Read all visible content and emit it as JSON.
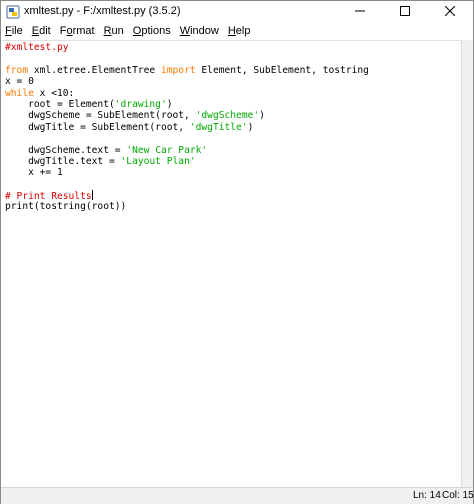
{
  "window": {
    "title": "xmltest.py - F:/xmltest.py (3.5.2)"
  },
  "menu": {
    "items": [
      {
        "accel": "F",
        "rest": "ile"
      },
      {
        "accel": "E",
        "rest": "dit"
      },
      {
        "pre": "F",
        "accel": "o",
        "rest": "rmat"
      },
      {
        "accel": "R",
        "rest": "un"
      },
      {
        "accel": "O",
        "rest": "ptions"
      },
      {
        "accel": "W",
        "rest": "indow"
      },
      {
        "accel": "H",
        "rest": "elp"
      }
    ]
  },
  "editor": {
    "lines": [
      {
        "indent": "",
        "parts": [
          {
            "t": "#xmltest.py",
            "c": "cmt"
          }
        ]
      },
      {
        "indent": "",
        "parts": []
      },
      {
        "indent": "",
        "parts": [
          {
            "t": "from",
            "c": "kw"
          },
          {
            "t": " xml.etree.ElementTree ",
            "c": ""
          },
          {
            "t": "import",
            "c": "kw"
          },
          {
            "t": " Element, SubElement, tostring",
            "c": ""
          }
        ]
      },
      {
        "indent": "",
        "parts": [
          {
            "t": "x = 0",
            "c": ""
          }
        ]
      },
      {
        "indent": "",
        "parts": [
          {
            "t": "while",
            "c": "kw"
          },
          {
            "t": " x <10:",
            "c": ""
          }
        ]
      },
      {
        "indent": "    ",
        "parts": [
          {
            "t": "root = Element(",
            "c": ""
          },
          {
            "t": "'drawing'",
            "c": "str"
          },
          {
            "t": ")",
            "c": ""
          }
        ]
      },
      {
        "indent": "    ",
        "parts": [
          {
            "t": "dwgScheme = SubElement(root, ",
            "c": ""
          },
          {
            "t": "'dwgScheme'",
            "c": "str"
          },
          {
            "t": ")",
            "c": ""
          }
        ]
      },
      {
        "indent": "    ",
        "parts": [
          {
            "t": "dwgTitle = SubElement(root, ",
            "c": ""
          },
          {
            "t": "'dwgTitle'",
            "c": "str"
          },
          {
            "t": ")",
            "c": ""
          }
        ]
      },
      {
        "indent": "",
        "parts": []
      },
      {
        "indent": "    ",
        "parts": [
          {
            "t": "dwgScheme.text = ",
            "c": ""
          },
          {
            "t": "'New Car Park'",
            "c": "str"
          }
        ]
      },
      {
        "indent": "    ",
        "parts": [
          {
            "t": "dwgTitle.text = ",
            "c": ""
          },
          {
            "t": "'Layout Plan'",
            "c": "str"
          }
        ]
      },
      {
        "indent": "    ",
        "parts": [
          {
            "t": "x += 1",
            "c": ""
          }
        ]
      },
      {
        "indent": "",
        "parts": []
      },
      {
        "indent": "",
        "parts": [
          {
            "t": "# Print Results",
            "c": "cmt"
          }
        ],
        "cursor": true
      },
      {
        "indent": "",
        "parts": [
          {
            "t": "print(tostring(root))",
            "c": ""
          }
        ]
      }
    ]
  },
  "status": {
    "ln": "Ln: 14",
    "col": "Col: 15"
  }
}
